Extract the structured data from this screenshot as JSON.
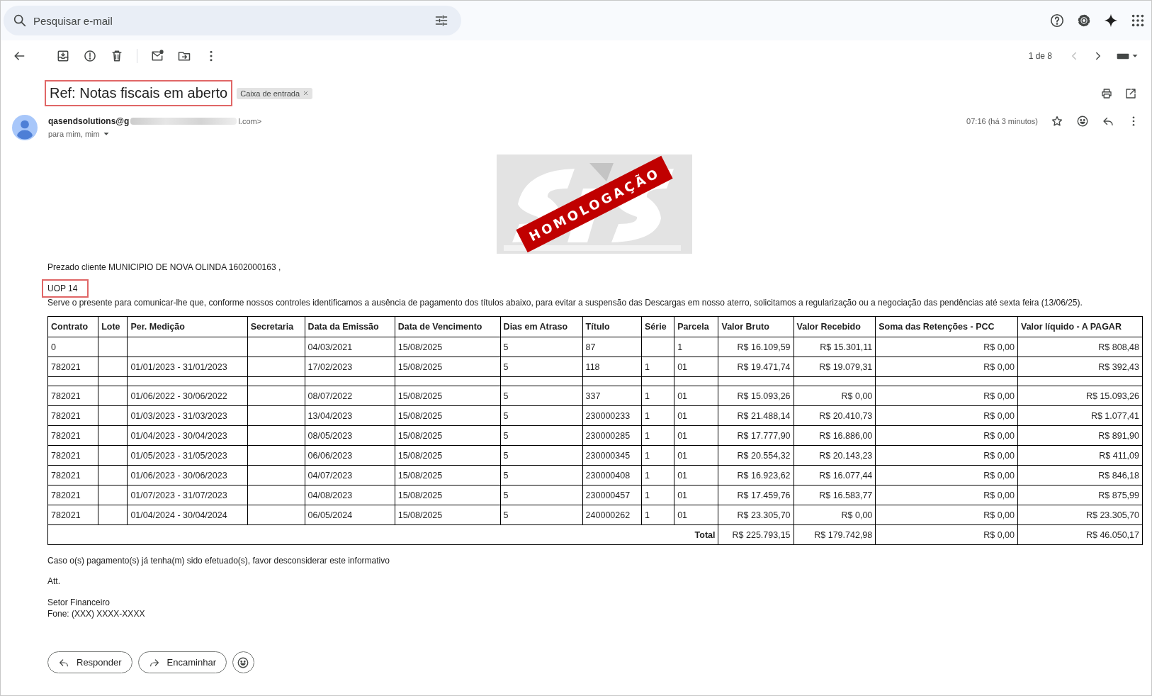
{
  "search": {
    "placeholder": "Pesquisar e-mail"
  },
  "pagination": {
    "text": "1 de 8",
    "prev_disabled": true
  },
  "subject": {
    "text": "Ref: Notas fiscais em aberto",
    "highlighted": true,
    "label": "Caixa de entrada"
  },
  "sender": {
    "address_start": "qasendsolutions@g",
    "address_end": "l.com>",
    "recipients": "para mim, mim",
    "time": "07:16 (há 3 minutos)"
  },
  "logo": {
    "banner": "HOMOLOGAÇÃO"
  },
  "body": {
    "greeting": "Prezado cliente MUNICIPIO DE NOVA OLINDA  1602000163 ,",
    "reference": "UOP 14",
    "reference_highlighted": true,
    "intro": "Serve o presente para comunicar-lhe que, conforme nossos controles identificamos a ausência de pagamento dos títulos abaixo, para evitar a suspensão das Descargas em nosso aterro, solicitamos a regularização ou a negociação das pendências  até sexta feira (13/06/25)."
  },
  "table": {
    "columns": [
      {
        "label": "Contrato",
        "kind": "text"
      },
      {
        "label": "Lote",
        "kind": "text"
      },
      {
        "label": "Per. Medição",
        "kind": "text"
      },
      {
        "label": "Secretaria",
        "kind": "text"
      },
      {
        "label": "Data da Emissão",
        "kind": "text"
      },
      {
        "label": "Data de Vencimento",
        "kind": "text"
      },
      {
        "label": "Dias em Atraso",
        "kind": "text"
      },
      {
        "label": "Título",
        "kind": "text"
      },
      {
        "label": "Série",
        "kind": "text"
      },
      {
        "label": "Parcela",
        "kind": "text"
      },
      {
        "label": "Valor Bruto",
        "kind": "money"
      },
      {
        "label": "Valor Recebido",
        "kind": "money"
      },
      {
        "label": "Soma das Retenções - PCC",
        "kind": "money"
      },
      {
        "label": "Valor líquido - A PAGAR",
        "kind": "money"
      }
    ],
    "rows": [
      {
        "kind": "data",
        "cells": [
          "0",
          null,
          null,
          null,
          "04/03/2021",
          "15/08/2025",
          "5",
          "87",
          null,
          "1",
          "R$ 16.109,59",
          "R$ 15.301,11",
          "R$ 0,00",
          "R$ 808,48"
        ]
      },
      {
        "kind": "data",
        "cells": [
          "782021",
          null,
          "01/01/2023 - 31/01/2023",
          null,
          "17/02/2023",
          "15/08/2025",
          "5",
          "118",
          "1",
          "01",
          "R$ 19.471,74",
          "R$ 19.079,31",
          "R$ 0,00",
          "R$ 392,43"
        ]
      },
      {
        "kind": "spacer"
      },
      {
        "kind": "data",
        "cells": [
          "782021",
          null,
          "01/06/2022 - 30/06/2022",
          null,
          "08/07/2022",
          "15/08/2025",
          "5",
          "337",
          "1",
          "01",
          "R$ 15.093,26",
          "R$ 0,00",
          "R$ 0,00",
          "R$ 15.093,26"
        ]
      },
      {
        "kind": "data",
        "cells": [
          "782021",
          null,
          "01/03/2023 - 31/03/2023",
          null,
          "13/04/2023",
          "15/08/2025",
          "5",
          "230000233",
          "1",
          "01",
          "R$ 21.488,14",
          "R$ 20.410,73",
          "R$ 0,00",
          "R$ 1.077,41"
        ]
      },
      {
        "kind": "data",
        "cells": [
          "782021",
          null,
          "01/04/2023 - 30/04/2023",
          null,
          "08/05/2023",
          "15/08/2025",
          "5",
          "230000285",
          "1",
          "01",
          "R$ 17.777,90",
          "R$ 16.886,00",
          "R$ 0,00",
          "R$ 891,90"
        ]
      },
      {
        "kind": "data",
        "cells": [
          "782021",
          null,
          "01/05/2023 - 31/05/2023",
          null,
          "06/06/2023",
          "15/08/2025",
          "5",
          "230000345",
          "1",
          "01",
          "R$ 20.554,32",
          "R$ 20.143,23",
          "R$ 0,00",
          "R$ 411,09"
        ]
      },
      {
        "kind": "data",
        "cells": [
          "782021",
          null,
          "01/06/2023 - 30/06/2023",
          null,
          "04/07/2023",
          "15/08/2025",
          "5",
          "230000408",
          "1",
          "01",
          "R$ 16.923,62",
          "R$ 16.077,44",
          "R$ 0,00",
          "R$ 846,18"
        ]
      },
      {
        "kind": "data",
        "cells": [
          "782021",
          null,
          "01/07/2023 - 31/07/2023",
          null,
          "04/08/2023",
          "15/08/2025",
          "5",
          "230000457",
          "1",
          "01",
          "R$ 17.459,76",
          "R$ 16.583,77",
          "R$ 0,00",
          "R$ 875,99"
        ]
      },
      {
        "kind": "data",
        "cells": [
          "782021",
          null,
          "01/04/2024 - 30/04/2024",
          null,
          "06/05/2024",
          "15/08/2025",
          "5",
          "240000262",
          "1",
          "01",
          "R$ 23.305,70",
          "R$ 0,00",
          "R$ 0,00",
          "R$ 23.305,70"
        ]
      }
    ],
    "total": {
      "label": "Total",
      "values": [
        "R$ 225.793,15",
        "R$ 179.742,98",
        "R$ 0,00",
        "R$ 46.050,17"
      ]
    }
  },
  "closing": [
    "Caso o(s) pagamento(s) já tenha(m) sido efetuado(s), favor desconsiderar este informativo",
    "Att."
  ],
  "signature": [
    "Setor Financeiro",
    "Fone: (XXX) XXXX-XXXX"
  ],
  "actions": [
    {
      "kind": "reply",
      "label": "Responder"
    },
    {
      "kind": "forward",
      "label": "Encaminhar"
    }
  ]
}
